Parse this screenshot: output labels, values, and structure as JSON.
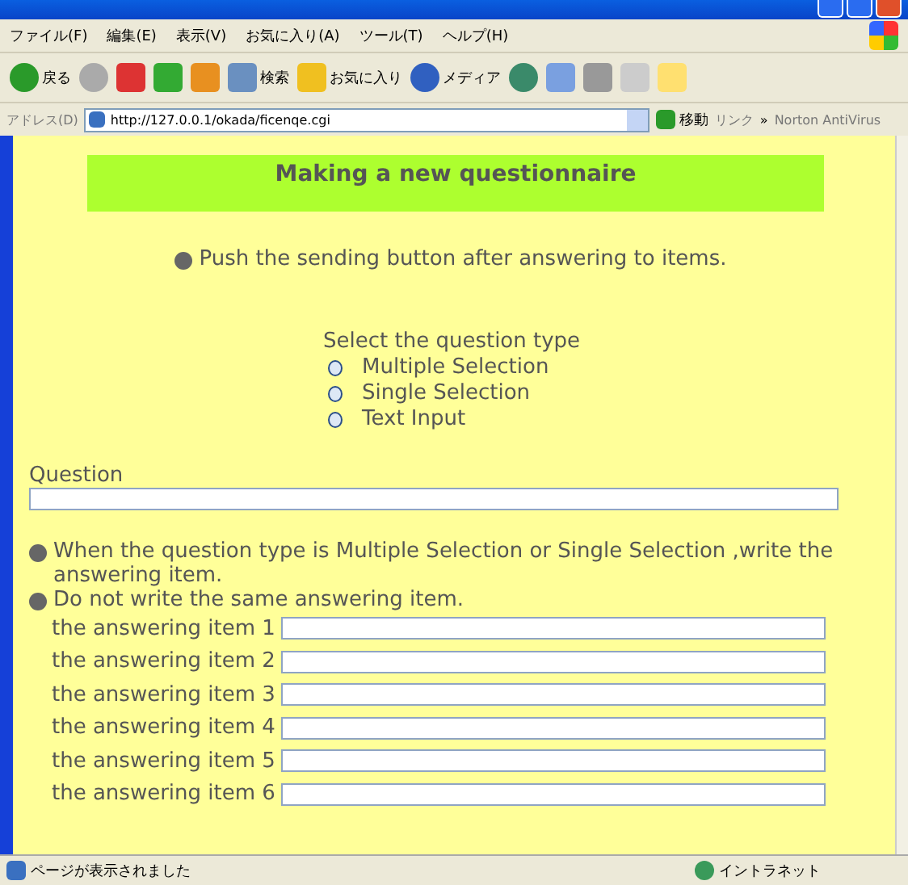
{
  "menu": [
    "ファイル(F)",
    "編集(E)",
    "表示(V)",
    "お気に入り(A)",
    "ツール(T)",
    "ヘルプ(H)"
  ],
  "toolbar": [
    {
      "kind": "back",
      "label": "戻る"
    },
    {
      "kind": "forward"
    },
    {
      "kind": "stop"
    },
    {
      "kind": "refresh"
    },
    {
      "kind": "home"
    },
    {
      "kind": "search",
      "label": "検索"
    },
    {
      "kind": "favorites",
      "label": "お気に入り"
    },
    {
      "kind": "media",
      "label": "メディア"
    },
    {
      "kind": "history"
    },
    {
      "kind": "mail"
    },
    {
      "kind": "print"
    },
    {
      "kind": "edit"
    },
    {
      "kind": "note"
    }
  ],
  "address": {
    "label": "アドレス(D)",
    "url": "http://127.0.0.1/okada/ficenqe.cgi",
    "go": "移動",
    "links": "リンク",
    "more": "»",
    "norton": "Norton AntiVirus"
  },
  "page": {
    "heading": "Making a new questionnaire",
    "note": "Push the sending button after answering to items.",
    "type_prompt": "Select the question type",
    "types": [
      {
        "label": "Multiple Selection",
        "selected": false
      },
      {
        "label": "Single Selection",
        "selected": false
      },
      {
        "label": "Text Input",
        "selected": false
      }
    ],
    "question_label": "Question",
    "notes": [
      "When the question type is Multiple Selection or Single Selection ,write the answering item.",
      "Do not write the same answering item."
    ],
    "items": [
      "the answering item 1",
      "the answering item 2",
      "the answering item 3",
      "the answering item 4",
      "the answering item 5",
      "the answering item 6"
    ]
  },
  "status_bar": {
    "message": "ページが表示されました",
    "zone": "イントラネット"
  }
}
